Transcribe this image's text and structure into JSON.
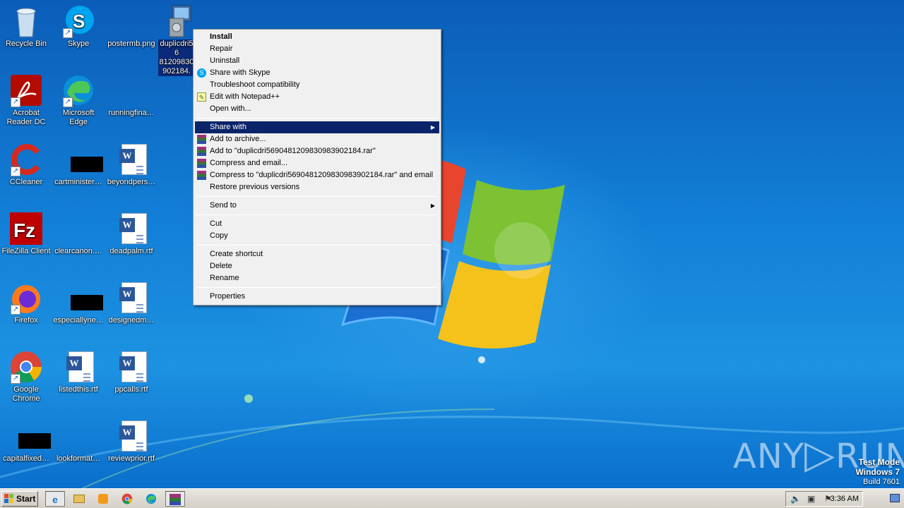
{
  "desktop_icons": [
    {
      "id": "recycle-bin",
      "label": "Recycle Bin",
      "icon": "recycle-bin-icon"
    },
    {
      "id": "skype",
      "label": "Skype",
      "icon": "skype-icon"
    },
    {
      "id": "postermb",
      "label": "postermb.png",
      "icon": "png-file-icon"
    },
    {
      "id": "duplicdri",
      "label": "duplicdri5690481209830983902184.msi",
      "label_visible": "duplicdri56\n81209830\n902184.",
      "icon": "msi-installer-icon"
    },
    {
      "id": "acrobat",
      "label": "Acrobat Reader DC",
      "icon": "acrobat-icon"
    },
    {
      "id": "edge",
      "label": "Microsoft Edge",
      "icon": "edge-icon"
    },
    {
      "id": "runningfina",
      "label": "runningfina…",
      "icon": "file-icon"
    },
    {
      "id": "ccleaner",
      "label": "CCleaner",
      "icon": "ccleaner-icon"
    },
    {
      "id": "cartminister",
      "label": "cartminister…",
      "icon": "black-file-icon"
    },
    {
      "id": "beyondpers",
      "label": "beyondpers…",
      "icon": "word-doc-icon"
    },
    {
      "id": "filezilla",
      "label": "FileZilla Client",
      "icon": "filezilla-icon"
    },
    {
      "id": "clearcanon",
      "label": "clearcanon.…",
      "icon": "file-icon"
    },
    {
      "id": "deadpalm",
      "label": "deadpalm.rtf",
      "icon": "word-doc-icon"
    },
    {
      "id": "firefox",
      "label": "Firefox",
      "icon": "firefox-icon"
    },
    {
      "id": "especiallyne",
      "label": "especiallyne…",
      "icon": "black-file-icon"
    },
    {
      "id": "designedm",
      "label": "designedm…",
      "icon": "word-doc-icon"
    },
    {
      "id": "chrome",
      "label": "Google Chrome",
      "icon": "chrome-icon"
    },
    {
      "id": "listedthis",
      "label": "listedthis.rtf",
      "icon": "word-doc-icon"
    },
    {
      "id": "ppcalls",
      "label": "ppcalls.rtf",
      "icon": "word-doc-icon"
    },
    {
      "id": "capitalfixed",
      "label": "capitalfixed…",
      "icon": "black-file-icon"
    },
    {
      "id": "lookformat",
      "label": "lookformat…",
      "icon": "file-icon"
    },
    {
      "id": "reviewprior",
      "label": "reviewprior.rtf",
      "icon": "word-doc-icon"
    }
  ],
  "context_menu": {
    "items": [
      {
        "label": "Install",
        "bold": true
      },
      {
        "label": "Repair"
      },
      {
        "label": "Uninstall"
      },
      {
        "label": "Share with Skype",
        "icon": "skype-icon"
      },
      {
        "label": "Troubleshoot compatibility"
      },
      {
        "label": "Edit with Notepad++",
        "icon": "notepad-plus-plus-icon"
      },
      {
        "label": "Open with..."
      },
      {
        "separator": true
      },
      {
        "label": "Share with",
        "submenu": true,
        "highlighted": true
      },
      {
        "label": "Add to archive...",
        "icon": "winrar-icon"
      },
      {
        "label": "Add to \"duplicdri5690481209830983902184.rar\"",
        "icon": "winrar-icon"
      },
      {
        "label": "Compress and email...",
        "icon": "winrar-icon"
      },
      {
        "label": "Compress to \"duplicdri5690481209830983902184.rar\" and email",
        "icon": "winrar-icon"
      },
      {
        "label": "Restore previous versions"
      },
      {
        "separator": true
      },
      {
        "label": "Send to",
        "submenu": true
      },
      {
        "separator": true
      },
      {
        "label": "Cut"
      },
      {
        "label": "Copy"
      },
      {
        "separator": true
      },
      {
        "label": "Create shortcut"
      },
      {
        "label": "Delete"
      },
      {
        "label": "Rename"
      },
      {
        "separator": true
      },
      {
        "label": "Properties"
      }
    ]
  },
  "taskbar": {
    "start_label": "Start",
    "pinned": [
      "ie-icon",
      "explorer-icon",
      "media-player-icon",
      "chrome-icon",
      "edge-icon",
      "winrar-icon"
    ],
    "clock": "3:36 AM"
  },
  "watermark": {
    "brand_left": "ANY",
    "brand_right": "RUN",
    "test_mode": "Test Mode",
    "os": "Windows 7",
    "build": "Build 7601"
  },
  "colors": {
    "menu_highlight": "#0a246a",
    "desktop_blue": "#127fd6",
    "taskbar": "#d4d0c8"
  }
}
